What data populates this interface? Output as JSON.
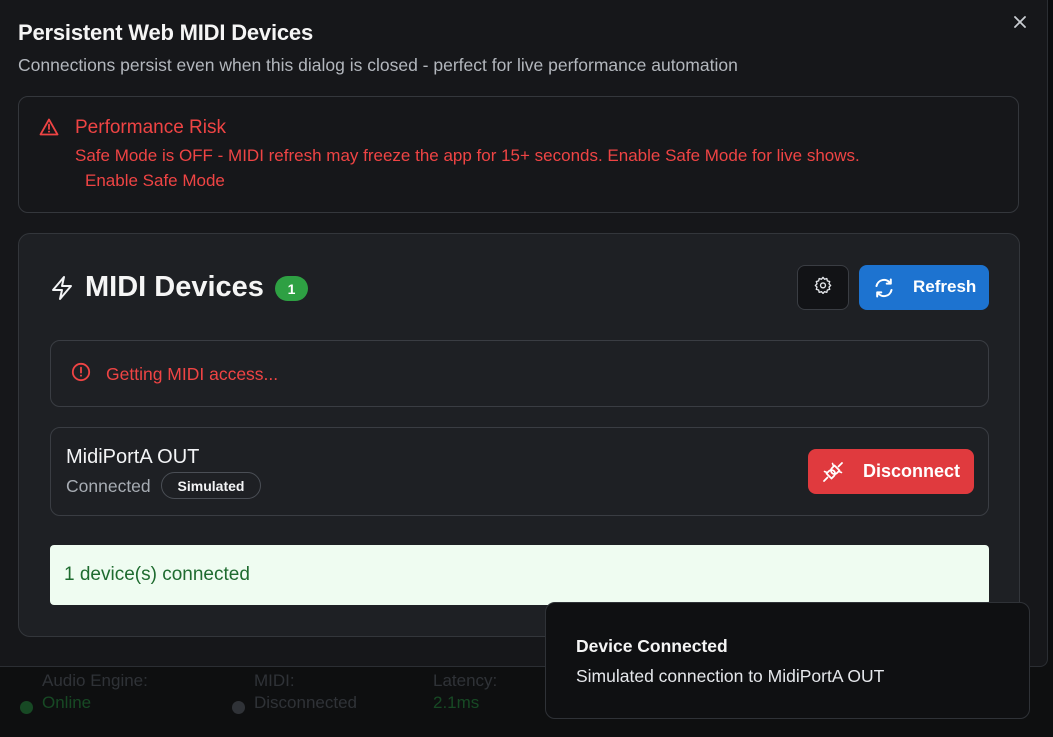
{
  "background_status": {
    "engine_label": "Audio Engine:",
    "engine_value": "Online",
    "midi_label": "MIDI:",
    "midi_value": "Disconnected",
    "latency_label": "Latency:",
    "latency_value": "2.1ms"
  },
  "dialog": {
    "title": "Persistent Web MIDI Devices",
    "subtitle": "Connections persist even when this dialog is closed - perfect for live performance automation",
    "close_icon": "close-icon"
  },
  "risk": {
    "icon": "warning-triangle-icon",
    "title": "Performance Risk",
    "message": "Safe Mode is OFF - MIDI refresh may freeze the app for 15+ seconds. Enable Safe Mode for live shows.",
    "link": "Enable Safe Mode"
  },
  "devices_card": {
    "icon": "lightning-icon",
    "title": "MIDI Devices",
    "count": "1",
    "settings_icon": "gear-icon",
    "refresh_icon": "refresh-icon",
    "refresh_label": "Refresh",
    "access_icon": "alert-circle-icon",
    "access_message": "Getting MIDI access...",
    "device": {
      "name": "MidiPortA OUT",
      "status": "Connected",
      "badge": "Simulated",
      "disconnect_icon": "unplug-icon",
      "disconnect_label": "Disconnect"
    },
    "summary": "1 device(s) connected"
  },
  "toast": {
    "title": "Device Connected",
    "description": "Simulated connection to MidiPortA OUT"
  },
  "colors": {
    "danger": "#ef4444",
    "primary": "#1d73d0",
    "success": "#2ea043",
    "disconnect": "#e03a3e",
    "surface": "#16171a"
  }
}
